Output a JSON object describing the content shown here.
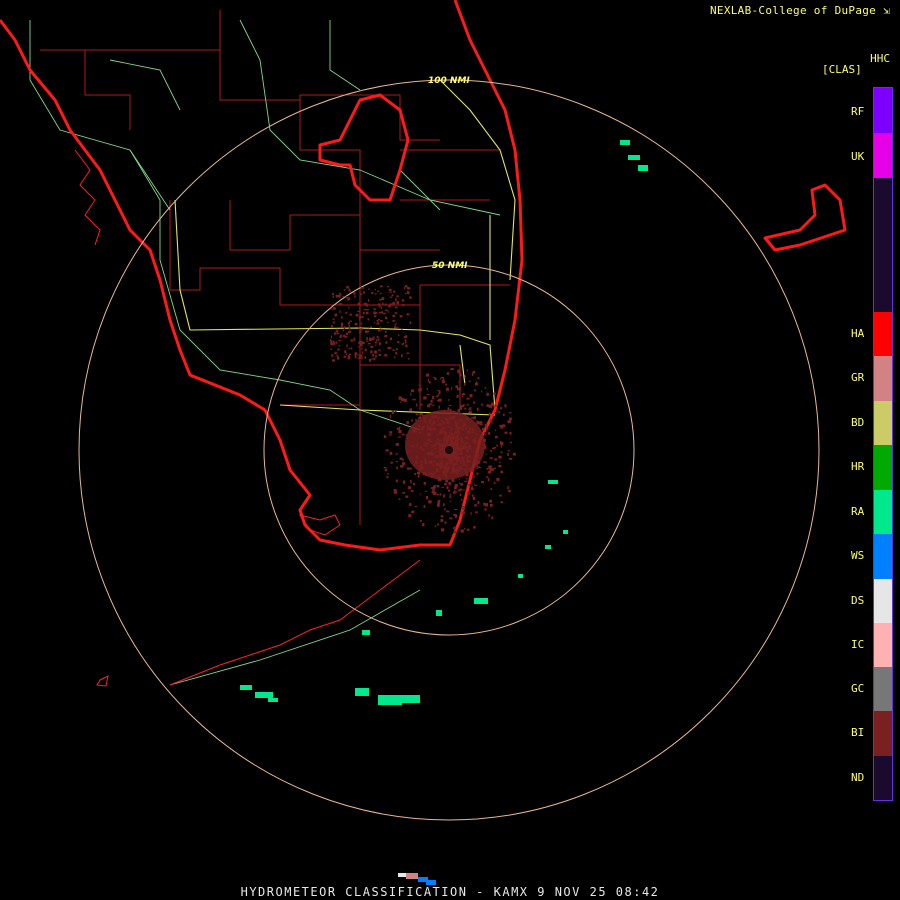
{
  "header": {
    "credit": "NEXLAB-College of DuPage",
    "credit_icon": "arrow-box-icon"
  },
  "legend": {
    "product_code": "HHC",
    "unit": "[CLAS]",
    "items": [
      {
        "code": "RF",
        "color": "#7d00ff"
      },
      {
        "code": "UK",
        "color": "#e600e6"
      },
      {
        "code": "HA",
        "color": "#ff0000"
      },
      {
        "code": "GR",
        "color": "#d28282"
      },
      {
        "code": "BD",
        "color": "#cccc66"
      },
      {
        "code": "HR",
        "color": "#00aa00"
      },
      {
        "code": "RA",
        "color": "#00e88c"
      },
      {
        "code": "WS",
        "color": "#0080ff"
      },
      {
        "code": "DS",
        "color": "#e6e6e6"
      },
      {
        "code": "IC",
        "color": "#ffb0b0"
      },
      {
        "code": "GC",
        "color": "#777777"
      },
      {
        "code": "BI",
        "color": "#7a2020"
      },
      {
        "code": "ND",
        "color": "#1a0a2e"
      }
    ]
  },
  "map": {
    "ring_labels": [
      "50 NMI",
      "100 NMI"
    ],
    "radar_site": "KAMX"
  },
  "footer": {
    "title": "HYDROMETEOR CLASSIFICATION - KAMX 9 NOV 25 08:42"
  }
}
